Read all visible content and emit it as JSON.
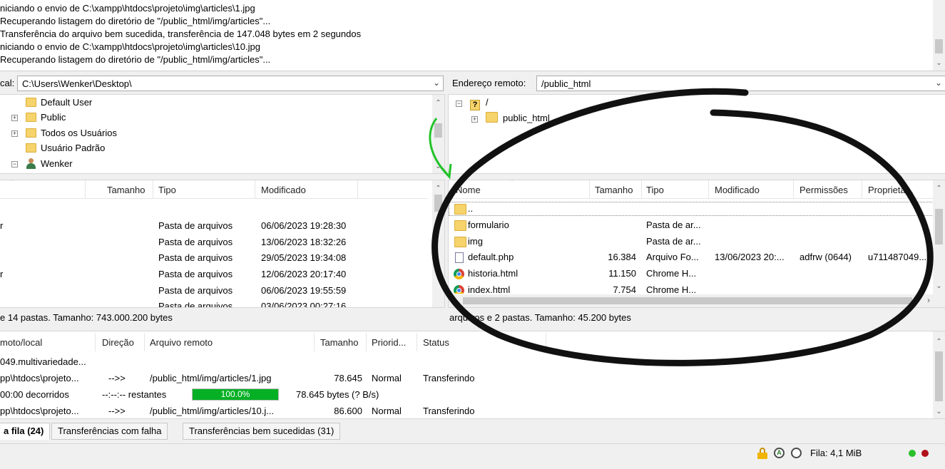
{
  "log": {
    "lines": [
      "niciando o envio de C:\\xampp\\htdocs\\projeto\\img\\articles\\1.jpg",
      "Recuperando listagem do diretório de \"/public_html/img/articles\"...",
      "Transferência do arquivo bem sucedida, transferência de 147.048 bytes em 2 segundos",
      "niciando o envio de C:\\xampp\\htdocs\\projeto\\img\\articles\\10.jpg",
      "Recuperando listagem do diretório de \"/public_html/img/articles\"..."
    ]
  },
  "local": {
    "label": "cal:",
    "path": "C:\\Users\\Wenker\\Desktop\\",
    "tree": [
      "Default User",
      "Public",
      "Todos os Usuários",
      "Usuário Padrão",
      "Wenker"
    ],
    "columns": [
      "Tamanho",
      "Tipo",
      "Modificado"
    ],
    "rows": [
      {
        "name": "",
        "type": "Pasta de arquivos",
        "modified": "06/06/2023 19:28:30"
      },
      {
        "name": "",
        "type": "Pasta de arquivos",
        "modified": "13/06/2023 18:32:26"
      },
      {
        "name": "",
        "type": "Pasta de arquivos",
        "modified": "29/05/2023 19:34:08"
      },
      {
        "name": "r",
        "type": "Pasta de arquivos",
        "modified": "12/06/2023 20:17:40"
      },
      {
        "name": "",
        "type": "Pasta de arquivos",
        "modified": "06/06/2023 19:55:59"
      },
      {
        "name": "",
        "type": "Pasta de arquivos",
        "modified": "03/06/2023 00:27:16"
      }
    ],
    "status": "e 14 pastas. Tamanho: 743.000.200 bytes"
  },
  "remote": {
    "label": "Endereço remoto:",
    "path": "/public_html",
    "tree_root": "/",
    "tree_child": "public_html",
    "columns": [
      "Nome",
      "Tamanho",
      "Tipo",
      "Modificado",
      "Permissões",
      "Proprietá..."
    ],
    "rows": [
      {
        "name": "..",
        "size": "",
        "type": "",
        "modified": "",
        "perm": "",
        "owner": "",
        "icon": "folder-icon"
      },
      {
        "name": "formulario",
        "size": "",
        "type": "Pasta de ar...",
        "modified": "",
        "perm": "",
        "owner": "",
        "icon": "folder-icon"
      },
      {
        "name": "img",
        "size": "",
        "type": "Pasta de ar...",
        "modified": "",
        "perm": "",
        "owner": "",
        "icon": "folder-icon"
      },
      {
        "name": "default.php",
        "size": "16.384",
        "type": "Arquivo Fo...",
        "modified": "13/06/2023 20:...",
        "perm": "adfrw (0644)",
        "owner": "u711487049...",
        "icon": "php-file-icon"
      },
      {
        "name": "historia.html",
        "size": "11.150",
        "type": "Chrome H...",
        "modified": "",
        "perm": "",
        "owner": "",
        "icon": "chrome-icon"
      },
      {
        "name": "index.html",
        "size": "7.754",
        "type": "Chrome H...",
        "modified": "",
        "perm": "",
        "owner": "",
        "icon": "chrome-icon"
      }
    ],
    "status": "arquivos e 2 pastas. Tamanho: 45.200 bytes"
  },
  "queue": {
    "columns": [
      "moto/local",
      "Direção",
      "Arquivo remoto",
      "Tamanho",
      "Priorid...",
      "Status"
    ],
    "rows": [
      {
        "local": "049.multivariedade...",
        "dir": "",
        "remote": "",
        "size": "",
        "prio": "",
        "status": ""
      },
      {
        "local": "pp\\htdocs\\projeto...",
        "dir": "-->>",
        "remote": "/public_html/img/articles/1.jpg",
        "size": "78.645",
        "prio": "Normal",
        "status": "Transferindo"
      },
      {
        "local": "00:00 decorridos",
        "dir": "--:--:-- restantes",
        "remote": "",
        "size": "78.645 bytes (? B/s)",
        "prio": "",
        "status": ""
      },
      {
        "local": "pp\\htdocs\\projeto...",
        "dir": "-->>",
        "remote": "/public_html/img/articles/10.j...",
        "size": "86.600",
        "prio": "Normal",
        "status": "Transferindo"
      }
    ],
    "progress_label": "100.0%",
    "progress_fraction": 1.0
  },
  "tabs": [
    "a fila (24)",
    "Transferências com falha",
    "Transferências bem sucedidas (31)"
  ],
  "statusbar": {
    "queue": "Fila: 4,1 MiB"
  },
  "colors": {
    "progress": "#06b025",
    "folder": "#f6d36b",
    "led_green": "#2bc02b",
    "led_red": "#b0101a"
  }
}
